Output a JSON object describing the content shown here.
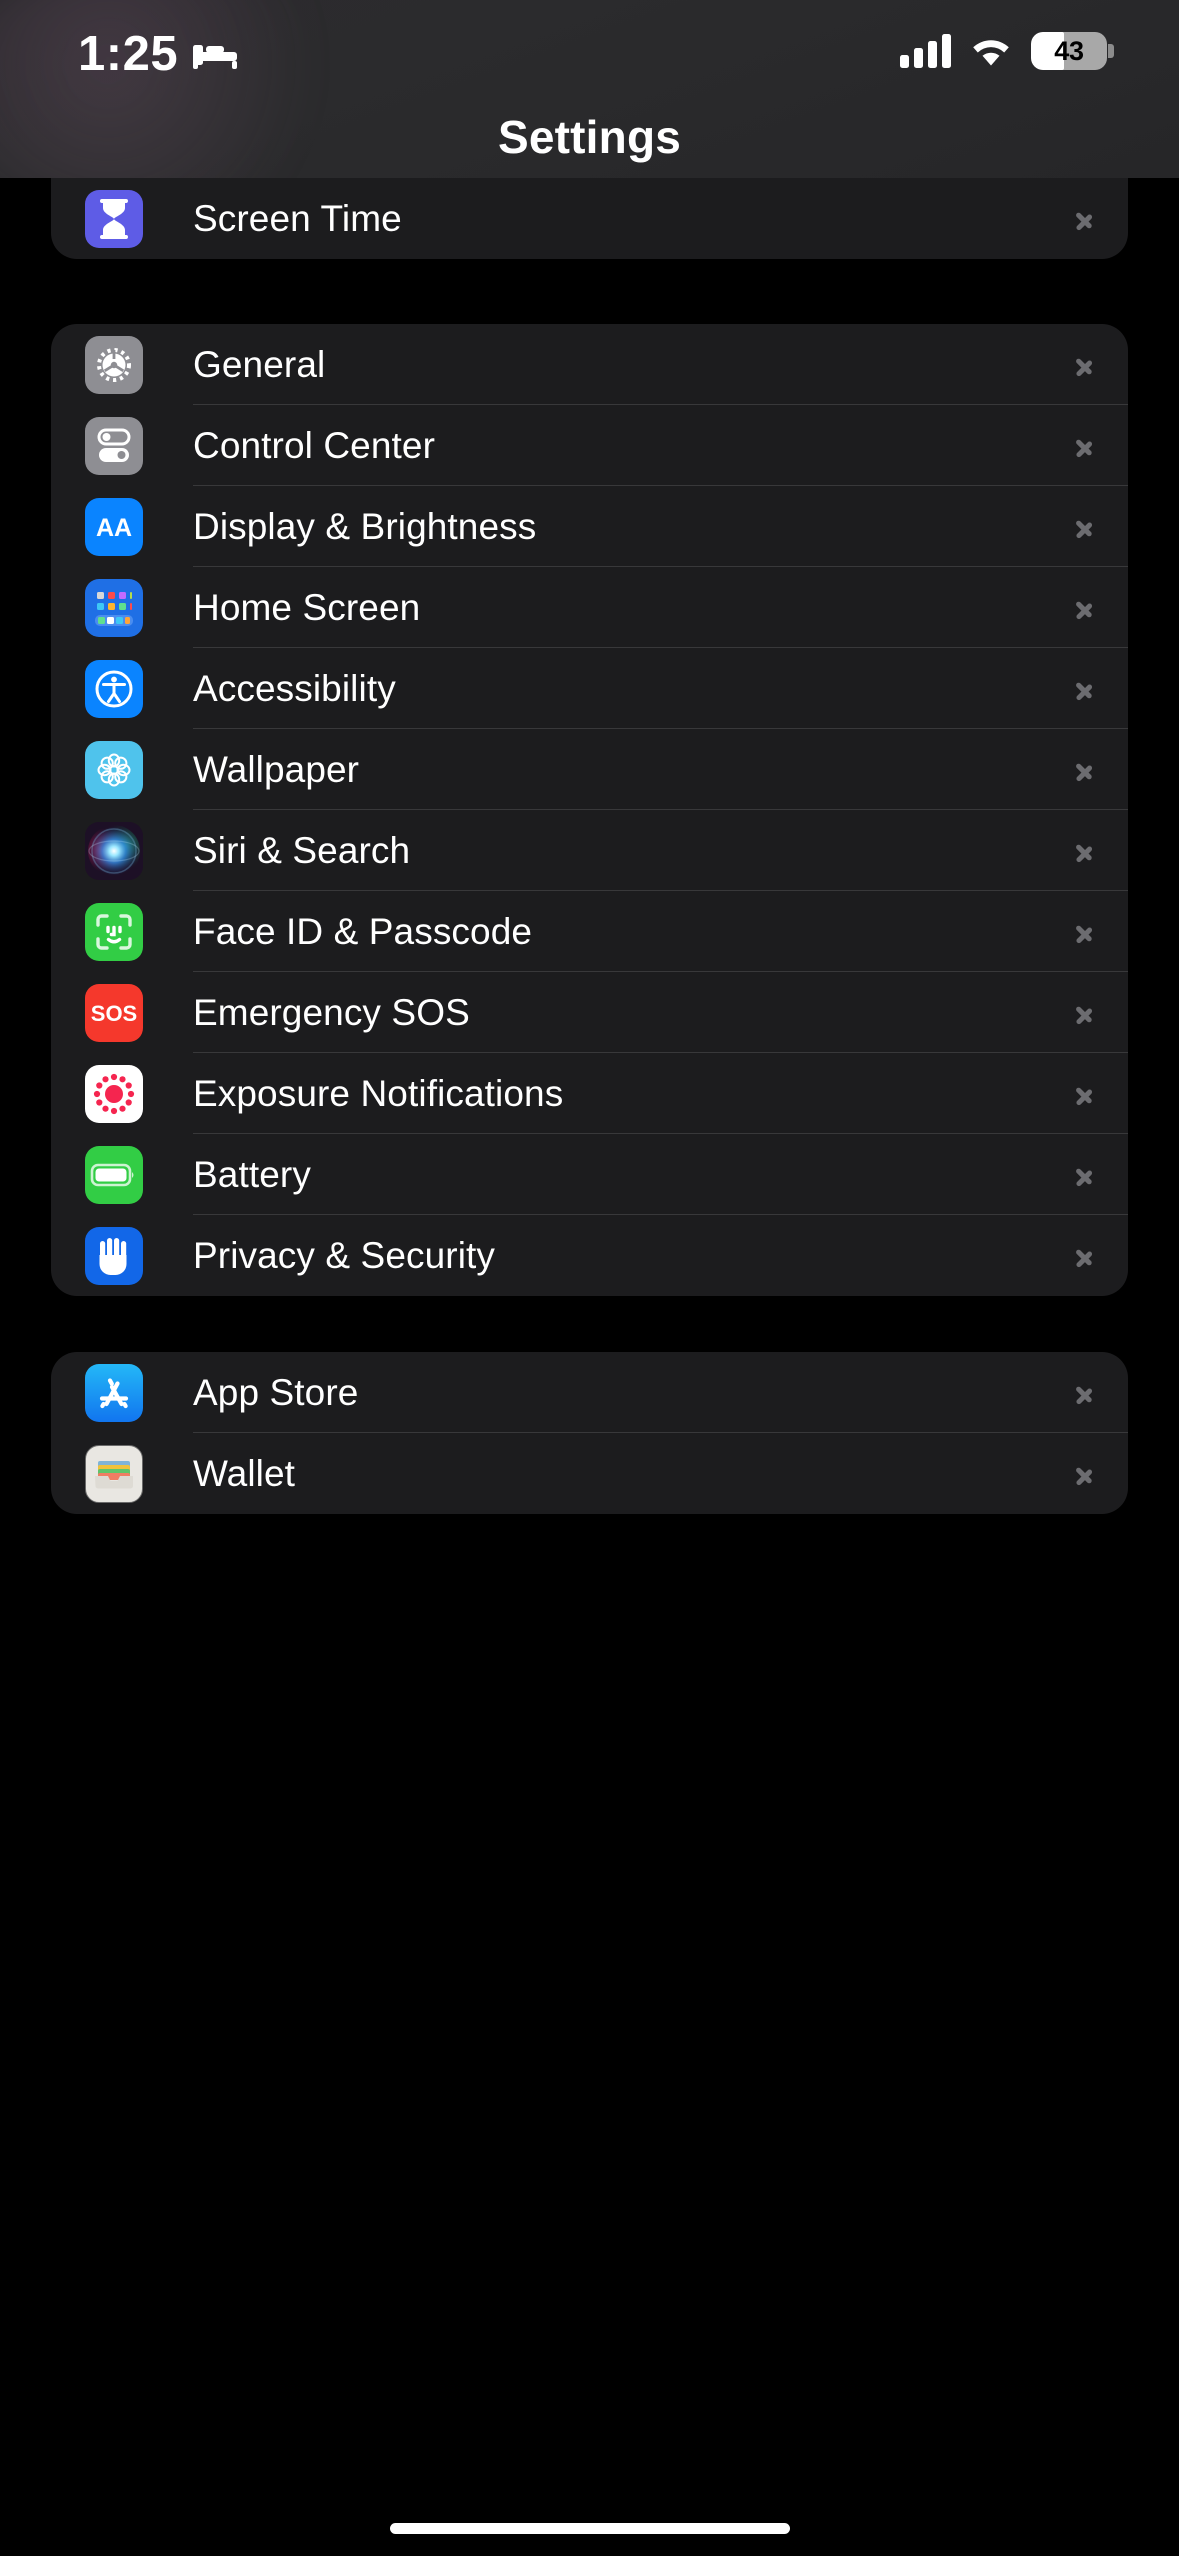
{
  "status_bar": {
    "time": "1:25",
    "focus_icon": "bed-icon",
    "cellular_icon": "signal-bars-icon",
    "cellular_bars": 4,
    "wifi_icon": "wifi-icon",
    "battery_percent": "43",
    "battery_level": 43
  },
  "nav": {
    "title": "Settings"
  },
  "groups": [
    {
      "name": "screen-time-group",
      "rows": [
        {
          "label": "Screen Time",
          "icon": "hourglass-icon",
          "icon_color": "#5e5ce6"
        }
      ]
    },
    {
      "name": "system-group",
      "rows": [
        {
          "label": "General",
          "icon": "gear-icon",
          "icon_color": "#8e8e93"
        },
        {
          "label": "Control Center",
          "icon": "toggles-icon",
          "icon_color": "#8e8e93"
        },
        {
          "label": "Display & Brightness",
          "icon": "aa-text-icon",
          "icon_color": "#0a84ff"
        },
        {
          "label": "Home Screen",
          "icon": "app-grid-icon",
          "icon_color": "#1f6fe5"
        },
        {
          "label": "Accessibility",
          "icon": "accessibility-icon",
          "icon_color": "#0a84ff"
        },
        {
          "label": "Wallpaper",
          "icon": "flower-icon",
          "icon_color": "#4fc3ec"
        },
        {
          "label": "Siri & Search",
          "icon": "siri-orb-icon",
          "icon_color": "#2a1a2e"
        },
        {
          "label": "Face ID & Passcode",
          "icon": "face-id-icon",
          "icon_color": "#32cd45"
        },
        {
          "label": "Emergency SOS",
          "icon": "sos-icon",
          "icon_color": "#f5382c"
        },
        {
          "label": "Exposure Notifications",
          "icon": "exposure-dots-icon",
          "icon_color": "#ffffff"
        },
        {
          "label": "Battery",
          "icon": "battery-icon",
          "icon_color": "#32cd45"
        },
        {
          "label": "Privacy & Security",
          "icon": "hand-icon",
          "icon_color": "#1267e8"
        }
      ]
    },
    {
      "name": "apps-group",
      "rows": [
        {
          "label": "App Store",
          "icon": "app-store-icon",
          "icon_color": "#1aa3f5"
        },
        {
          "label": "Wallet",
          "icon": "wallet-icon",
          "icon_color": "#e8e6e1"
        }
      ]
    }
  ],
  "colors": {
    "background": "#000000",
    "group_background": "#1c1c1e",
    "separator": "#38383a",
    "label_text": "#ffffff",
    "chevron": "#6c6c70",
    "navbar": "#2b2b2d"
  },
  "home_indicator": "home-indicator"
}
